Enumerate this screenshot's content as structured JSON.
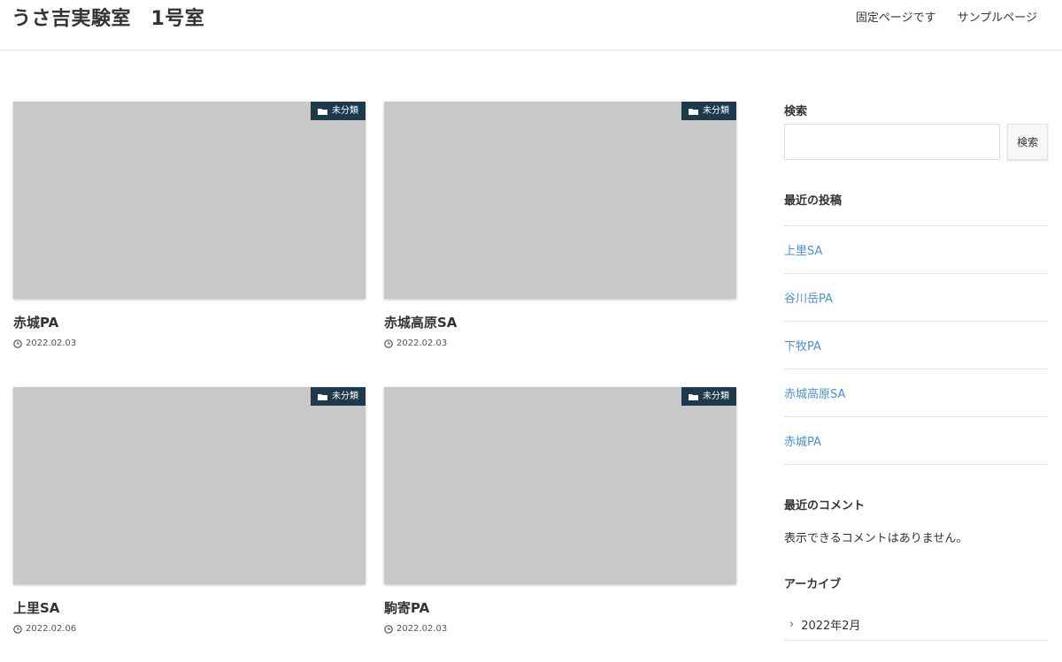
{
  "header": {
    "site_title": "うさ吉実験室　1号室",
    "nav": [
      "固定ページです",
      "サンプルページ"
    ]
  },
  "posts": [
    {
      "title": "赤城PA",
      "date": "2022.02.03",
      "category": "未分類"
    },
    {
      "title": "赤城高原SA",
      "date": "2022.02.03",
      "category": "未分類"
    },
    {
      "title": "上里SA",
      "date": "2022.02.06",
      "category": "未分類"
    },
    {
      "title": "駒寄PA",
      "date": "2022.02.03",
      "category": "未分類"
    }
  ],
  "sidebar": {
    "search": {
      "title": "検索",
      "placeholder": "",
      "button_label": "検索"
    },
    "recent_posts": {
      "title": "最近の投稿",
      "items": [
        "上里SA",
        "谷川岳PA",
        "下牧PA",
        "赤城高原SA",
        "赤城PA"
      ]
    },
    "recent_comments": {
      "title": "最近のコメント",
      "empty_text": "表示できるコメントはありません。"
    },
    "archives": {
      "title": "アーカイブ",
      "items": [
        "2022年2月"
      ]
    }
  },
  "colors": {
    "badge_bg": "#1d3a4d",
    "thumb_bg": "#c8c8c8",
    "link": "#4a90d9"
  },
  "icons": {
    "category": "folder-icon",
    "date": "clock-icon",
    "archive_item": "chevron-right-icon"
  }
}
